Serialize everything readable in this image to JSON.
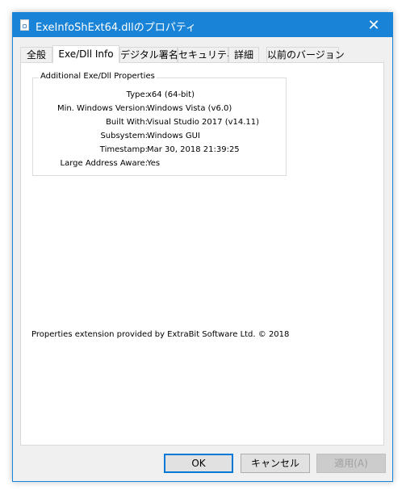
{
  "window": {
    "title": "ExeInfoShExt64.dllのプロパティ",
    "close_glyph": "✕"
  },
  "tabs": [
    {
      "label": "全般",
      "active": false
    },
    {
      "label": "Exe/Dll Info",
      "active": true
    },
    {
      "label": "デジタル署名",
      "active": false
    },
    {
      "label": "セキュリティ",
      "active": false
    },
    {
      "label": "詳細",
      "active": false
    },
    {
      "label": "以前のバージョン",
      "active": false
    }
  ],
  "properties_group": {
    "label": "Additional Exe/Dll Properties",
    "rows": [
      {
        "name": "Type:",
        "value": "x64 (64-bit)"
      },
      {
        "name": "Min. Windows Version:",
        "value": "Windows Vista (v6.0)"
      },
      {
        "name": "Built With:",
        "value": "Visual Studio 2017 (v14.11)"
      },
      {
        "name": "Subsystem:",
        "value": "Windows GUI"
      },
      {
        "name": "Timestamp:",
        "value": "Mar 30, 2018 21:39:25"
      },
      {
        "name": "Large Address Aware:",
        "value": "Yes"
      }
    ]
  },
  "footer_text": "Properties extension provided by ExtraBit Software Ltd. © 2018",
  "buttons": {
    "ok": "OK",
    "cancel": "キャンセル",
    "apply": "適用(A)"
  },
  "colors": {
    "accent": "#1883d7",
    "panel": "#ffffff",
    "dialog": "#f0f0f0"
  }
}
